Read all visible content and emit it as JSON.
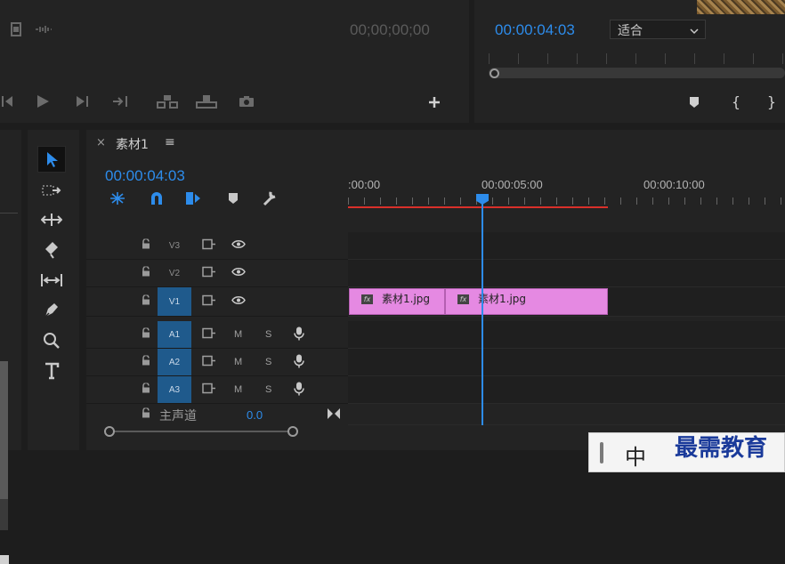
{
  "source_monitor": {
    "timecode": "00;00;00;00"
  },
  "program_monitor": {
    "timecode": "00:00:04:03",
    "fit_label": "适合"
  },
  "timeline": {
    "tab_name": "素材1",
    "close_glyph": "×",
    "menu_glyph": "≡",
    "timecode": "00:00:04:03",
    "ruler": [
      ":00:00",
      "00:00:05:00",
      "00:00:10:00"
    ],
    "video_tracks": [
      {
        "name": "V3",
        "active": false
      },
      {
        "name": "V2",
        "active": false
      },
      {
        "name": "V1",
        "active": true
      }
    ],
    "audio_tracks": [
      {
        "name": "A1",
        "m": "M",
        "s": "S"
      },
      {
        "name": "A2",
        "m": "M",
        "s": "S"
      },
      {
        "name": "A3",
        "m": "M",
        "s": "S"
      }
    ],
    "master": {
      "label": "主声道",
      "value": "0.0"
    },
    "clips": [
      "素材1.jpg",
      "素材1.jpg"
    ],
    "fx_label": "fx"
  },
  "ime": {
    "lang": "中",
    "watermark": "最需教育"
  },
  "colors": {
    "accent": "#2d8ceb",
    "clip": "#e589e2",
    "track_active": "#1f5a8c",
    "work_area": "#d9302a"
  }
}
